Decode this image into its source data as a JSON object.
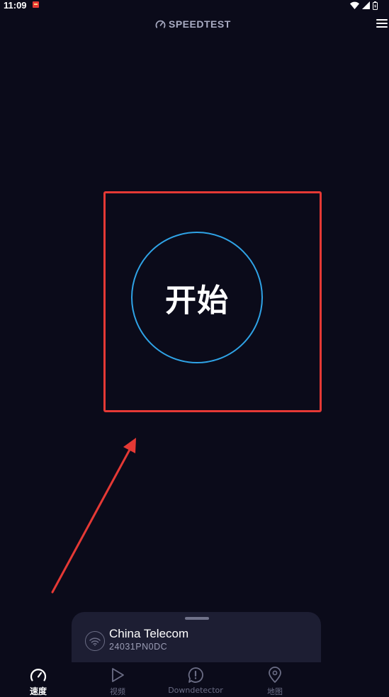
{
  "status_bar": {
    "time": "11:09"
  },
  "header": {
    "brand": "SPEEDTEST"
  },
  "main": {
    "go_label": "开始"
  },
  "provider": {
    "name": "China Telecom",
    "id": "24031PN0DC"
  },
  "nav": {
    "items": [
      {
        "label": "速度",
        "icon": "speedometer-icon",
        "active": true
      },
      {
        "label": "视频",
        "icon": "play-icon",
        "active": false
      },
      {
        "label": "Downdetector",
        "icon": "alert-icon",
        "active": false
      },
      {
        "label": "地图",
        "icon": "map-pin-icon",
        "active": false
      }
    ]
  },
  "colors": {
    "background": "#0b0b1a",
    "accent": "#2fa3e6",
    "highlight": "#e53935",
    "card": "#1d1e33",
    "muted": "#6b6d85"
  }
}
